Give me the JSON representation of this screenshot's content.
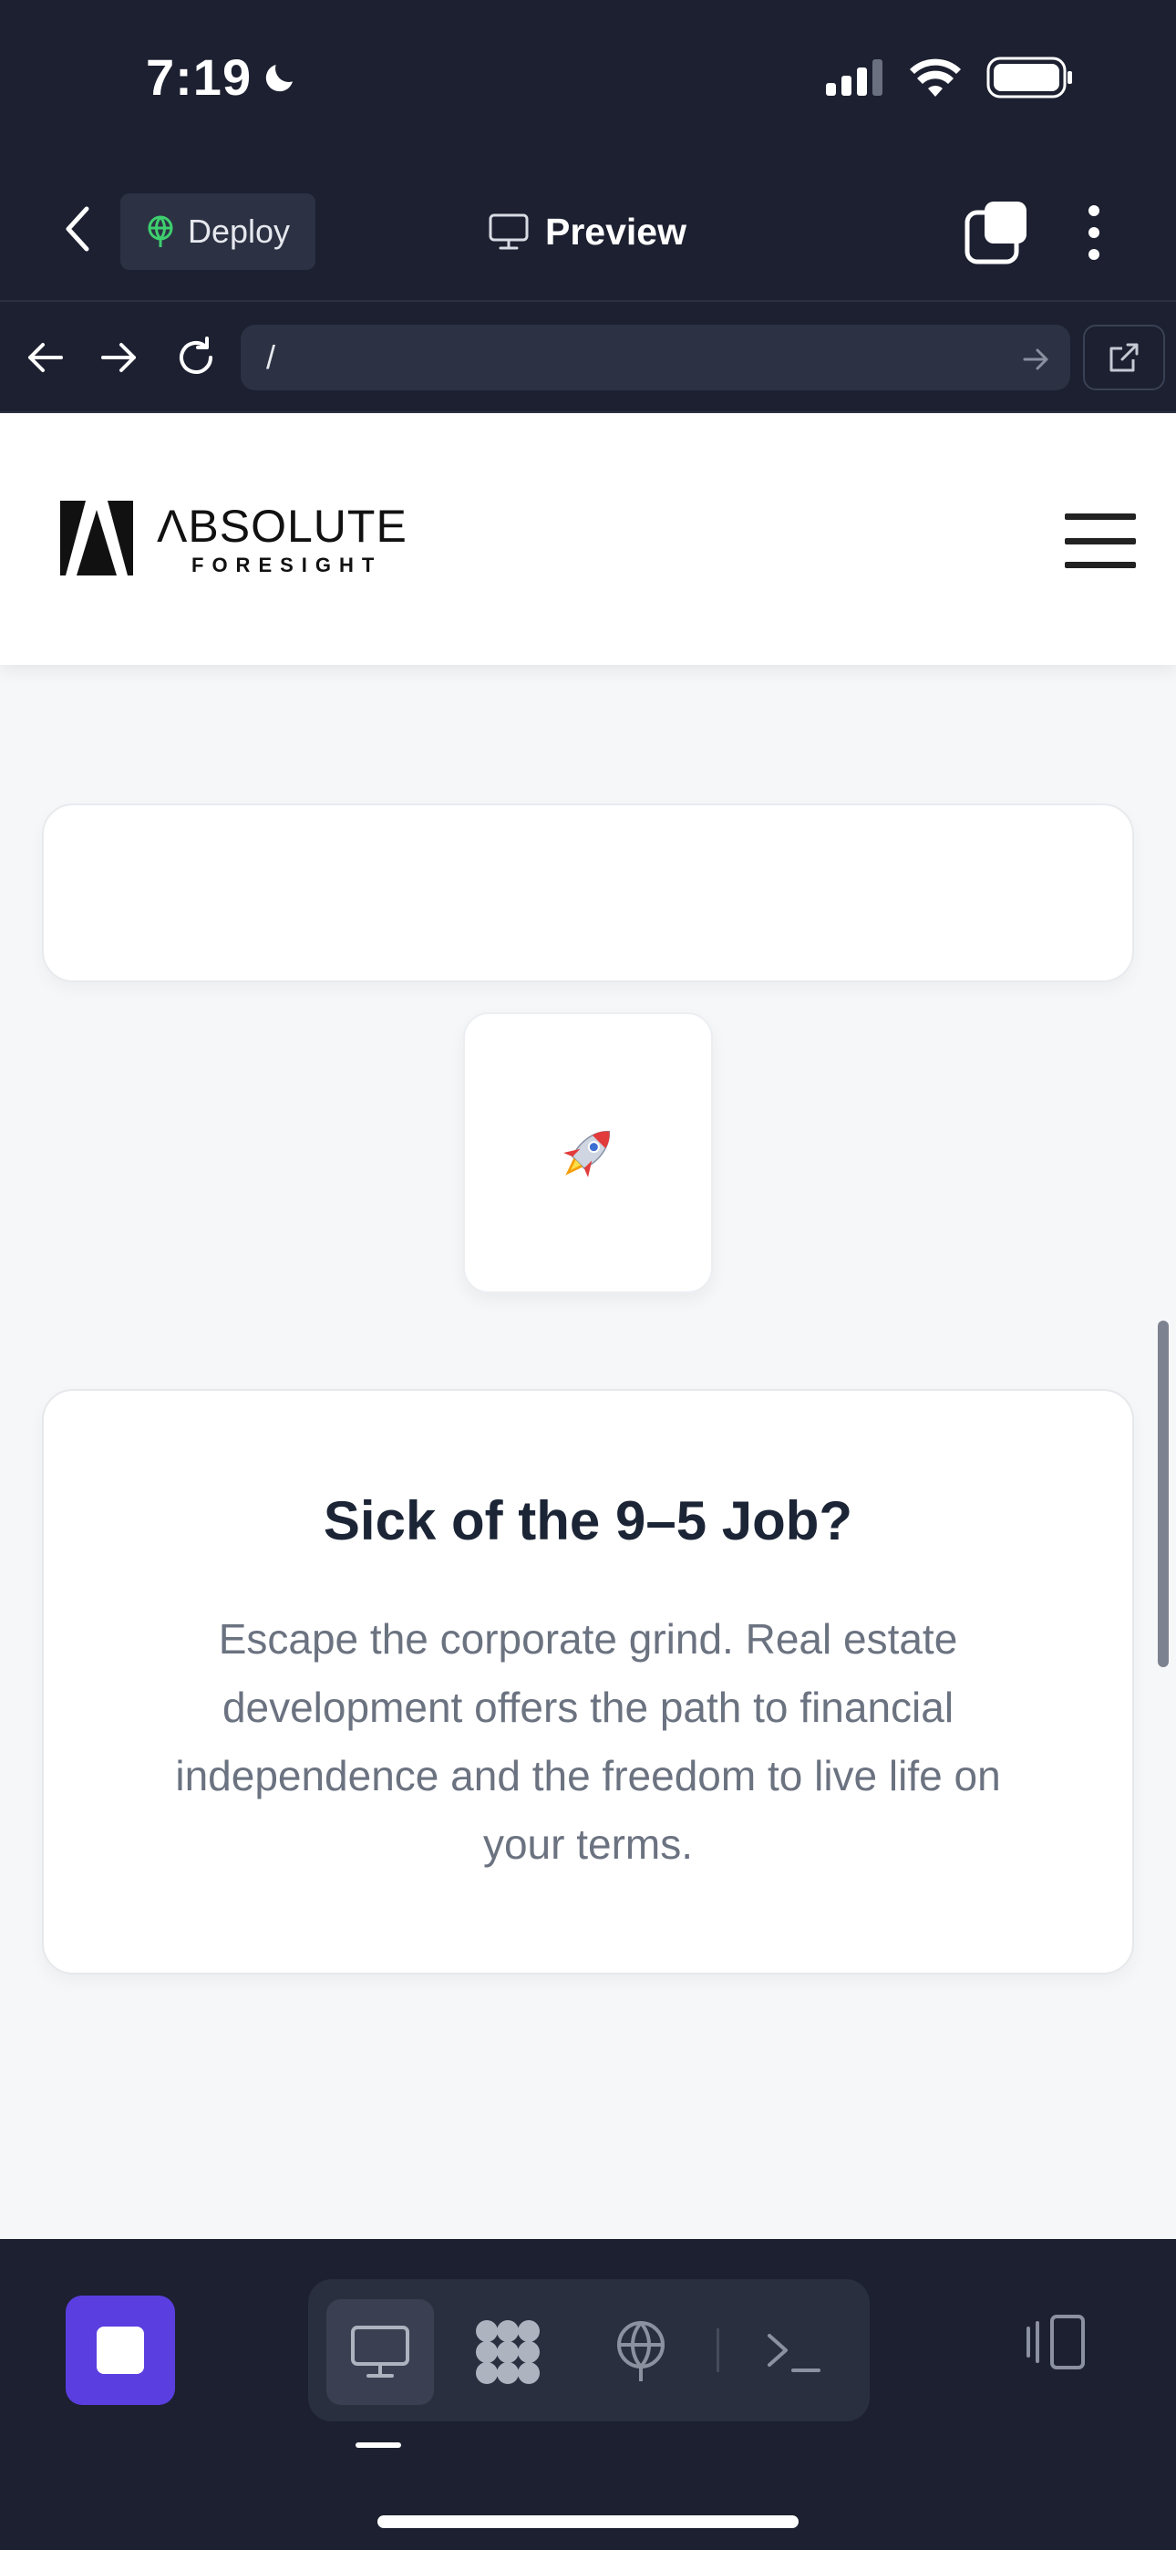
{
  "status_bar": {
    "time": "7:19"
  },
  "top_bar": {
    "deploy_label": "Deploy",
    "preview_label": "Preview"
  },
  "url_bar": {
    "value": "/"
  },
  "site": {
    "logo_main": "ΛBSOLUTE",
    "logo_sub": "FORESIGHT",
    "rocket_emoji": "🚀",
    "info_card": {
      "title": "Sick of the 9–5 Job?",
      "body": "Escape the corporate grind. Real estate development offers the path to financial independence and the freedom to live life on your terms."
    }
  },
  "colors": {
    "chrome_bg": "#1c2030",
    "chip_bg": "#2c3244",
    "accent_purple": "#5b3ee0",
    "deploy_green": "#3ecf6e",
    "page_bg": "#f6f7f9"
  },
  "icons": {
    "back": "chevron-left-icon",
    "deploy": "globe-icon",
    "preview": "monitor-icon",
    "tabs": "tabs-icon",
    "more": "more-vertical-icon",
    "nav_back": "arrow-left-icon",
    "nav_forward": "arrow-right-icon",
    "reload": "reload-icon",
    "go": "arrow-right-icon",
    "open_external": "external-link-icon",
    "menu": "hamburger-menu-icon",
    "stop": "stop-icon",
    "preview_tool": "monitor-icon",
    "workspace_tool": "grid-icon",
    "deploy_tool": "globe-icon",
    "console_tool": "terminal-icon",
    "panel": "panel-toggle-icon"
  }
}
